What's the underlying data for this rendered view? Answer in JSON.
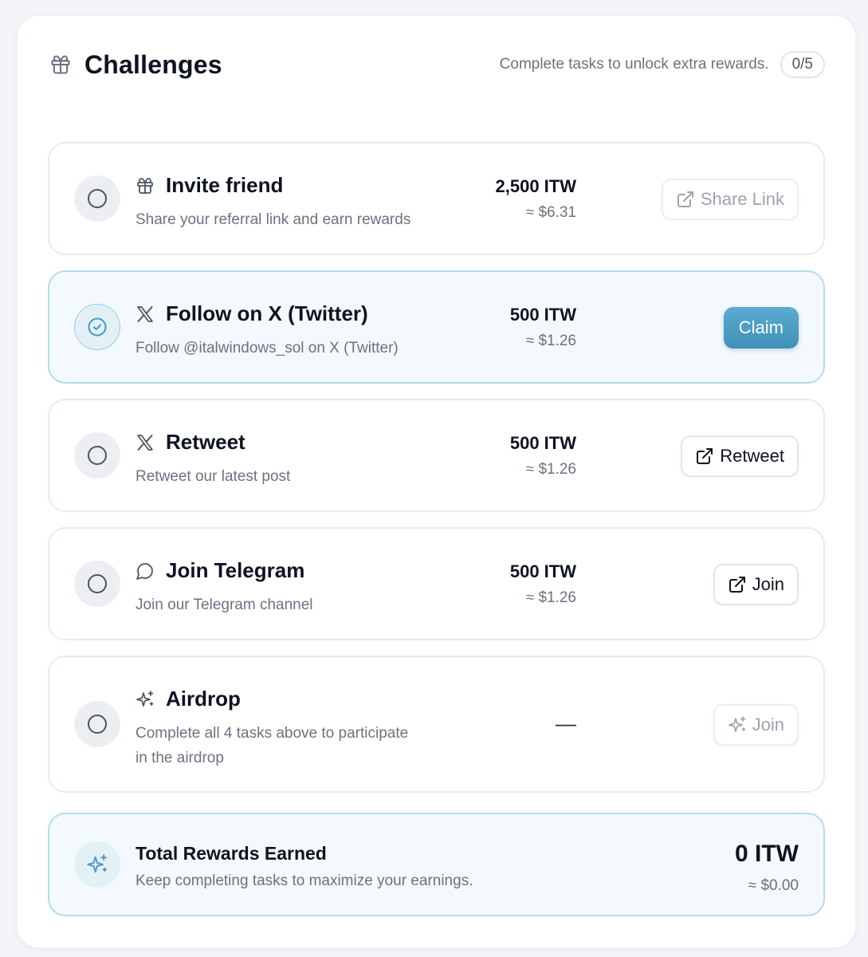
{
  "header": {
    "title": "Challenges",
    "subtitle": "Complete tasks to unlock extra rewards.",
    "progress": "0/5",
    "icon": "gift-icon"
  },
  "tasks": [
    {
      "title": "Invite friend",
      "desc": "Share your referral link and earn rewards",
      "amount": "2,500 ITW",
      "usd": "≈ $6.31",
      "button": "Share Link",
      "icon": "gift-icon"
    },
    {
      "title": "Follow on X (Twitter)",
      "desc": "Follow @italwindows_sol on X (Twitter)",
      "amount": "500 ITW",
      "usd": "≈ $1.26",
      "button": "Claim",
      "icon": "x-logo-icon"
    },
    {
      "title": "Retweet",
      "desc": "Retweet our latest post",
      "amount": "500 ITW",
      "usd": "≈ $1.26",
      "button": "Retweet",
      "icon": "x-logo-icon"
    },
    {
      "title": "Join Telegram",
      "desc": "Join our Telegram channel",
      "amount": "500 ITW",
      "usd": "≈ $1.26",
      "button": "Join",
      "icon": "chat-bubble-icon"
    },
    {
      "title": "Airdrop",
      "desc_line1": "Complete all 4 tasks above to participate",
      "desc_line2": "in the airdrop",
      "amount": "—",
      "button": "Join",
      "icon": "sparkles-icon"
    }
  ],
  "total": {
    "title": "Total Rewards Earned",
    "desc": "Keep completing tasks to maximize your earnings.",
    "amount": "0 ITW",
    "usd": "≈ $0.00",
    "icon": "sparkles-icon"
  },
  "colors": {
    "accent": "#4a9cc4",
    "active_bg": "#f3f9fc",
    "active_border": "#b4dcea",
    "muted_text": "#6b7280"
  }
}
